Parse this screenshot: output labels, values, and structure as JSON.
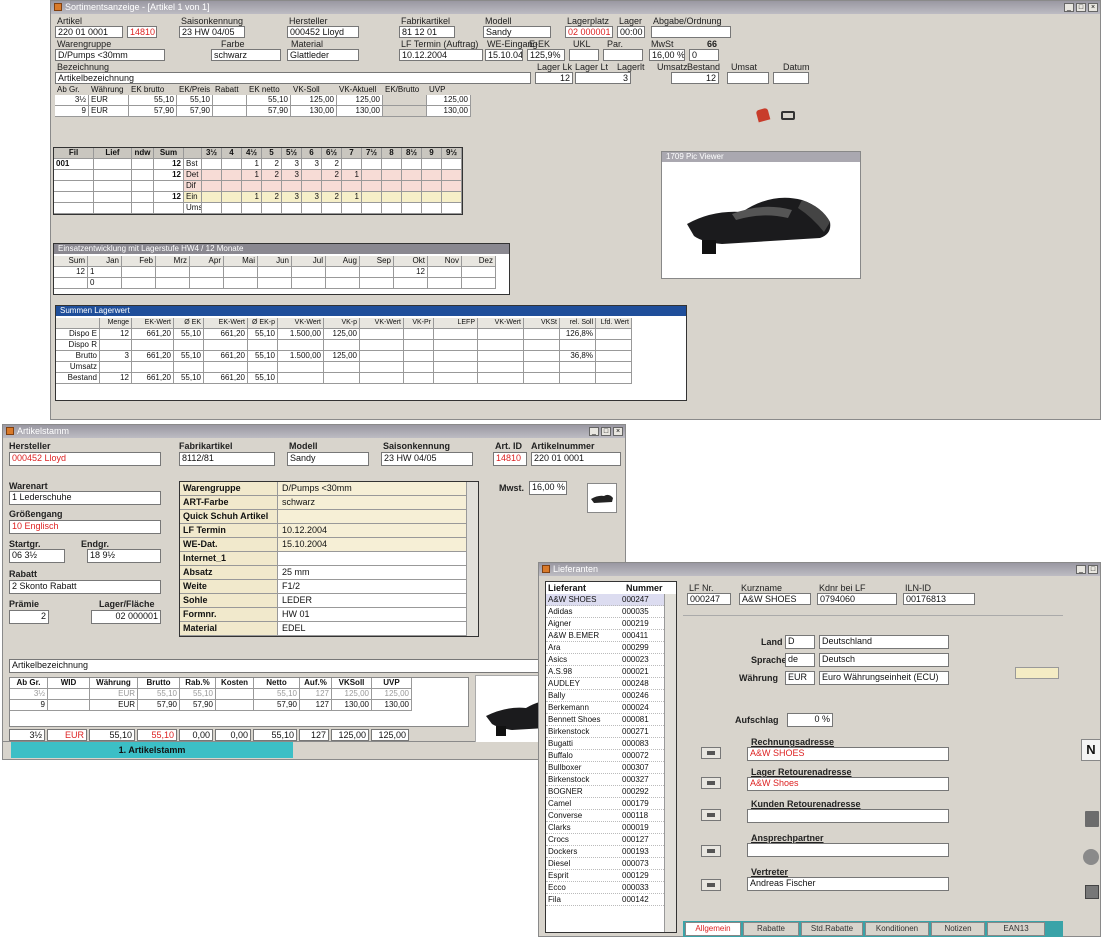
{
  "w1": {
    "title": "Sortimentsanzeige - [Artikel 1 von 1]",
    "labels": {
      "artikel": "Artikel",
      "saison": "Saisonkennung",
      "hersteller": "Hersteller",
      "fabrikat": "Fabrikartikel",
      "modell": "Modell",
      "lagerplatz": "Lagerplatz",
      "lager": "Lager",
      "abgabe": "Abgabe/Ordnung",
      "warengruppe": "Warengruppe",
      "farbe": "Farbe",
      "material": "Material",
      "lftermin": "LF Termin (Auftrag)",
      "weeingang": "WE-Eingang",
      "ekek": "E-EK",
      "ukl": "UKL",
      "par": "Par.",
      "mwst": "MwSt",
      "bezeichnung": "Bezeichnung",
      "lagerla": "Lager Lk",
      "lagerlt": "Lager Lt",
      "lagerlr": "Lagerlt",
      "umsatz": "Umsatz",
      "bestand": "Bestand",
      "umsat2": "Umsat",
      "datum": "Datum",
      "datum2": "Datum"
    },
    "values": {
      "artikel": "220 01 0001",
      "artnr": "14810",
      "saison": "23 HW 04/05",
      "hersteller": "000452 Lloyd",
      "fabrikat": "81 12 01",
      "modell": "Sandy",
      "lagerplatz": "02 000001",
      "lager": "00:00",
      "warengruppe": "D/Pumps <30mm",
      "farbe": "schwarz",
      "material": "Glattleder",
      "lftermin": "10.12.2004",
      "weeingang": "15.10.04",
      "ekek": "125,9%",
      "mwst": "16,00 %",
      "mwst2": "66",
      "mwst3": "0",
      "bezeichnung": "Artikelbezeichnung",
      "lagerla": "12",
      "lagerlt": "3",
      "bestand": "12"
    },
    "price_headers": [
      "Ab Gr.",
      "Währung",
      "EK brutto",
      "EK/Preis",
      "Rabatt",
      "EK netto",
      "VK-Soll",
      "VK-Aktuell",
      "EK/Brutto",
      "UVP"
    ],
    "price_rows": [
      [
        "3½",
        "EUR",
        "55,10",
        "55,10",
        "",
        "55,10",
        "125,00",
        "125,00",
        "",
        "125,00"
      ],
      [
        "9",
        "EUR",
        "57,90",
        "57,90",
        "",
        "57,90",
        "130,00",
        "130,00",
        "",
        "130,00"
      ]
    ],
    "size_headers": [
      "Fil",
      "Lief",
      "ndw",
      "Sum",
      "",
      "3½",
      "4",
      "4½",
      "5",
      "5½",
      "6",
      "6½",
      "7",
      "7½",
      "8",
      "8½",
      "9",
      "9½"
    ],
    "size_rows": [
      [
        "001",
        "",
        "",
        "12",
        "Bst",
        "",
        "",
        "1",
        "2",
        "3",
        "3",
        "2",
        "",
        "",
        "",
        "",
        "",
        ""
      ],
      [
        "",
        "",
        "",
        "12",
        "Det",
        "",
        "",
        "1",
        "2",
        "3",
        "",
        "2",
        "1",
        "",
        "",
        "",
        "",
        ""
      ],
      [
        "",
        "",
        "",
        "",
        "Dif",
        "",
        "",
        "",
        "",
        "",
        "",
        "",
        "",
        "",
        "",
        "",
        "",
        ""
      ],
      [
        "",
        "",
        "",
        "12",
        "Ein",
        "",
        "",
        "1",
        "2",
        "3",
        "3",
        "2",
        "1",
        "",
        "",
        "",
        "",
        ""
      ],
      [
        "",
        "",
        "",
        "",
        "Ums",
        "",
        "",
        "",
        "",
        "",
        "",
        "",
        "",
        "",
        "",
        "",
        "",
        ""
      ]
    ],
    "monthly": {
      "title": "Einsatzentwicklung mit Lagerstufe HW4 / 12 Monate",
      "headers": [
        "Sum",
        "Jan",
        "Feb",
        "Mrz",
        "Apr",
        "Mai",
        "Jun",
        "Jul",
        "Aug",
        "Sep",
        "Okt",
        "Nov",
        "Dez"
      ],
      "rows": [
        [
          "12",
          "1",
          "",
          "",
          "",
          "",
          "",
          "",
          "",
          "",
          "12",
          "",
          ""
        ],
        [
          "",
          "0",
          "",
          "",
          "",
          "",
          "",
          "",
          "",
          "",
          "",
          "",
          ""
        ]
      ]
    },
    "summary": {
      "title": "Summen Lagerwert",
      "headers": [
        "",
        "Menge",
        "EK-Wert",
        "Ø EK",
        "EK-Wert",
        "Ø EK-p",
        "VK-Wert",
        "VK-p",
        "VK-Wert",
        "VK-Pr",
        "LEFP",
        "VK-Wert",
        "VKSt",
        "rel. Soll",
        "Lfd. Wert"
      ],
      "rows": [
        [
          "Dispo E",
          "12",
          "661,20",
          "55,10",
          "661,20",
          "55,10",
          "1.500,00",
          "125,00",
          "",
          "",
          "",
          "",
          "",
          "126,8%",
          ""
        ],
        [
          "Dispo R",
          "",
          "",
          "",
          "",
          "",
          "",
          "",
          "",
          "",
          "",
          "",
          "",
          "",
          ""
        ],
        [
          "Brutto",
          "3",
          "661,20",
          "55,10",
          "661,20",
          "55,10",
          "1.500,00",
          "125,00",
          "",
          "",
          "",
          "",
          "",
          "36,8%",
          ""
        ],
        [
          "Umsatz",
          "",
          "",
          "",
          "",
          "",
          "",
          "",
          "",
          "",
          "",
          "",
          "",
          "",
          ""
        ],
        [
          "Bestand",
          "12",
          "661,20",
          "55,10",
          "661,20",
          "55,10",
          "",
          "",
          "",
          "",
          "",
          "",
          "",
          "",
          ""
        ]
      ]
    },
    "image_title": "1709 Pic Viewer"
  },
  "w2": {
    "title": "Artikelstamm",
    "labels": {
      "hersteller": "Hersteller",
      "fabrikat": "Fabrikartikel",
      "modell": "Modell",
      "saison": "Saisonkennung",
      "artid": "Art. ID",
      "artnr": "Artikelnummer",
      "warenart": "Warenart",
      "groessengang": "Größengang",
      "startgr": "Startgr.",
      "endgr": "Endgr.",
      "rabatt": "Rabatt",
      "praemie": "Prämie",
      "lagerfl": "Lager/Fläche",
      "mwst": "Mwst.",
      "beschr": "Artikelbezeichnung",
      "tab": "1. Artikelstamm"
    },
    "values": {
      "hersteller": "000452 Lloyd",
      "fabrikat": "8112/81",
      "modell": "Sandy",
      "saison": "23 HW 04/05",
      "artid": "14810",
      "artnr": "220 01 0001",
      "warenart": "1 Lederschuhe",
      "groessengang": "10 Englisch",
      "startgr": "06 3½",
      "endgr": "18 9½",
      "rabatt": "2 Skonto Rabatt",
      "praemie": "2",
      "lagerfl": "02 000001",
      "mwst": "16,00 %"
    },
    "props": [
      [
        "Warengruppe",
        "D/Pumps <30mm"
      ],
      [
        "ART-Farbe",
        "schwarz"
      ],
      [
        "Quick Schuh Artikel",
        ""
      ],
      [
        "LF Termin",
        "10.12.2004"
      ],
      [
        "WE-Dat.",
        "15.10.2004"
      ],
      [
        "Internet_1",
        ""
      ],
      [
        "Absatz",
        "25 mm"
      ],
      [
        "Weite",
        "F1/2"
      ],
      [
        "Sohle",
        "LEDER"
      ],
      [
        "Formnr.",
        "HW 01"
      ],
      [
        "Material",
        "EDEL"
      ]
    ],
    "price_headers": [
      "Ab Gr.",
      "WID",
      "Währung",
      "Brutto",
      "Rab.%",
      "Kosten",
      "Netto",
      "Auf.%",
      "VKSoll",
      "UVP"
    ],
    "price_rows": [
      [
        "3½",
        "",
        "EUR",
        "55,10",
        "55,10",
        "",
        "55,10",
        "127",
        "125,00",
        "125,00"
      ],
      [
        "9",
        "",
        "EUR",
        "57,90",
        "57,90",
        "",
        "57,90",
        "127",
        "130,00",
        "130,00"
      ]
    ],
    "edit_row": [
      "3½",
      "EUR",
      "55,10",
      "55,10",
      "0,00",
      "0,00",
      "55,10",
      "127",
      "125,00",
      "125,00"
    ]
  },
  "w3": {
    "title": "Lieferanten",
    "list_headers": [
      "Lieferant",
      "Nummer"
    ],
    "list": [
      [
        "A&W SHOES",
        "000247"
      ],
      [
        "Adidas",
        "000035"
      ],
      [
        "Aigner",
        "000219"
      ],
      [
        "A&W B.EMER",
        "000411"
      ],
      [
        "Ara",
        "000299"
      ],
      [
        "Asics",
        "000023"
      ],
      [
        "A.S.98",
        "000021"
      ],
      [
        "AUDLEY",
        "000248"
      ],
      [
        "Bally",
        "000246"
      ],
      [
        "Berkemann",
        "000024"
      ],
      [
        "Bennett Shoes",
        "000081"
      ],
      [
        "Birkenstock",
        "000271"
      ],
      [
        "Bugatti",
        "000083"
      ],
      [
        "Buffalo",
        "000072"
      ],
      [
        "Bullboxer",
        "000307"
      ],
      [
        "Birkenstock",
        "000327"
      ],
      [
        "BOGNER",
        "000292"
      ],
      [
        "Camel",
        "000179"
      ],
      [
        "Converse",
        "000118"
      ],
      [
        "Clarks",
        "000019"
      ],
      [
        "Crocs",
        "000127"
      ],
      [
        "Dockers",
        "000193"
      ],
      [
        "Diesel",
        "000073"
      ],
      [
        "Esprit",
        "000129"
      ],
      [
        "Ecco",
        "000033"
      ],
      [
        "Fila",
        "000142"
      ]
    ],
    "labels": {
      "lfnr": "LF Nr.",
      "kurzname": "Kurzname",
      "kdnr": "Kdnr bei LF",
      "ilnid": "ILN-ID",
      "land": "Land",
      "sprache": "Sprache",
      "waehrung": "Währung",
      "aufschlag": "Aufschlag",
      "rechnung": "Rechnungsadresse",
      "lager": "Lager Retourenadresse",
      "kunden": "Kunden Retourenadresse",
      "ansprech": "Ansprechpartner",
      "vertreter": "Vertreter"
    },
    "values": {
      "lfnr": "000247",
      "kurzname": "A&W SHOES",
      "kdnr": "0794060",
      "ilnid": "00176813",
      "land_code": "D",
      "land": "Deutschland",
      "sprache_code": "de",
      "sprache": "Deutsch",
      "waehrung_code": "EUR",
      "waehrung": "Euro Währungseinheit (ECU)",
      "aufschlag": "0 %",
      "rechnung": "A&W SHOES",
      "lager": "A&W Shoes",
      "kunden": "",
      "ansprech": "",
      "vertreter": "Andreas Fischer"
    },
    "tabs": [
      "Allgemein",
      "Rabatte",
      "Std.Rabatte",
      "Konditionen",
      "Notizen",
      "EAN13"
    ]
  }
}
